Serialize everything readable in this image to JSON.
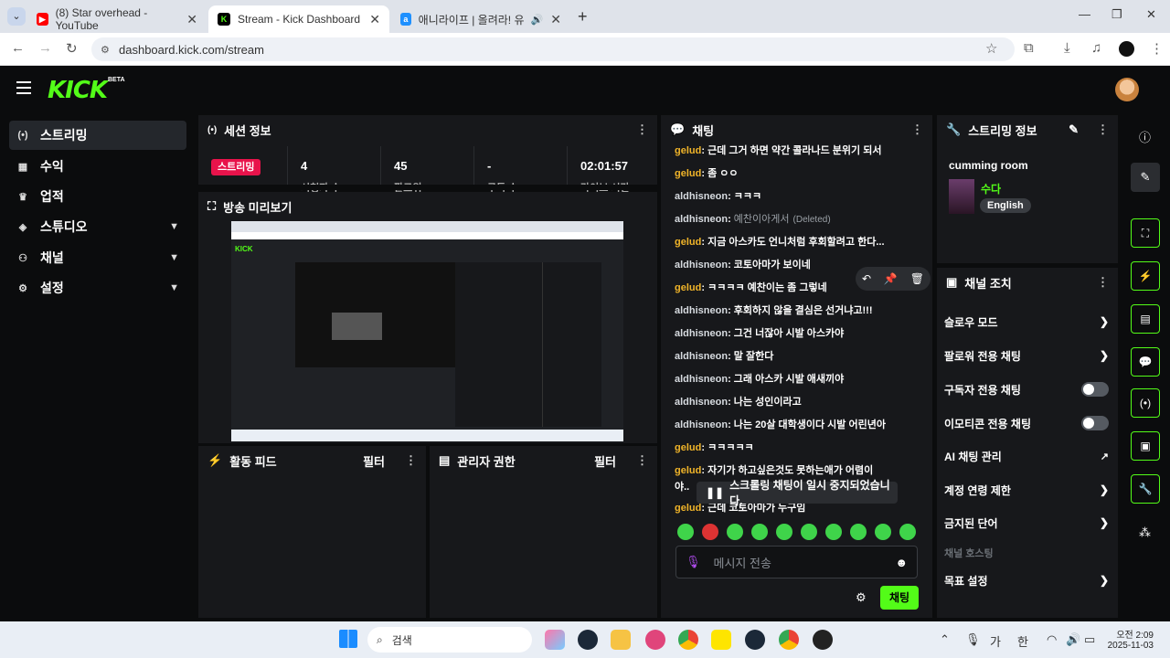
{
  "browser": {
    "tabs": [
      {
        "title": "(8) Star overhead - YouTube",
        "color": "#ff0000",
        "glyph": "▶"
      },
      {
        "title": "Stream - Kick Dashboard",
        "color": "#53fc18",
        "glyph": "K"
      },
      {
        "title": "애니라이프 | 올려라! 유포니",
        "color": "#1e90ff",
        "glyph": "a"
      }
    ],
    "url": "dashboard.kick.com/stream"
  },
  "header": {
    "logo": "KICK",
    "beta": "BETA"
  },
  "sidebar": {
    "items": [
      {
        "label": "스트리밍",
        "icon": "broadcast-icon",
        "glyph": "(•)"
      },
      {
        "label": "수익",
        "icon": "chart-icon",
        "glyph": "▦"
      },
      {
        "label": "업적",
        "icon": "trophy-icon",
        "glyph": "♛"
      },
      {
        "label": "스튜디오",
        "icon": "layers-icon",
        "glyph": "◈",
        "chev": "⌄"
      },
      {
        "label": "채널",
        "icon": "users-icon",
        "glyph": "⚇",
        "chev": "⌄"
      },
      {
        "label": "설정",
        "icon": "gear-icon",
        "glyph": "⚙",
        "chev": "⌄"
      }
    ]
  },
  "session": {
    "title": "세션 정보",
    "live": "스트리밍",
    "stats": [
      {
        "value": "4",
        "label": "시청자 수"
      },
      {
        "value": "45",
        "label": "팔로워"
      },
      {
        "value": "-",
        "label": "구독 수"
      },
      {
        "value": "02:01:57",
        "label": "라이브 시간"
      }
    ]
  },
  "preview": {
    "title": "방송 미리보기"
  },
  "activity": {
    "title": "활동 피드",
    "filter": "필터"
  },
  "modperm": {
    "title": "관리자 권한",
    "filter": "필터"
  },
  "chat": {
    "title": "채팅",
    "messages": [
      {
        "user": "gelud",
        "text": "근데 그거 하면 약간 콜라나드 분위기 되서",
        "t": "gelud: ",
        "msg": "근데 그거 하면 약간 콜라나드 분위기 되서"
      },
      {
        "user": "gelud",
        "msg": "좀 ㅇㅇ"
      },
      {
        "user": "aldhisneon",
        "msg": "ㅋㅋㅋ"
      },
      {
        "user": "aldhisneon",
        "msg": "예찬이아게서",
        "deleted": "(Deleted)"
      },
      {
        "user": "gelud",
        "msg": "지금 아스카도 언니처럼 후회할려고 한다..."
      },
      {
        "user": "aldhisneon",
        "msg": "코토아마가 보이네"
      },
      {
        "user": "gelud",
        "msg": "ㅋㅋㅋㅋ 예찬이는 좀 그렇네"
      },
      {
        "user": "aldhisneon",
        "msg": "후회하지 않을 결심은 선거냐고!!!"
      },
      {
        "user": "aldhisneon",
        "msg": "그건 너잖아 시발 아스카야"
      },
      {
        "user": "aldhisneon",
        "msg": "말 잘한다"
      },
      {
        "user": "aldhisneon",
        "msg": "그래 아스카 시발 애새끼야"
      },
      {
        "user": "aldhisneon",
        "msg": "나는 성인이라고"
      },
      {
        "user": "aldhisneon",
        "msg": "나는 20살 대학생이다 시발 어린년아"
      },
      {
        "user": "gelud",
        "msg": "ㅋㅋㅋㅋㅋ"
      },
      {
        "user": "gelud",
        "msg": "자기가 하고싶은것도 못하는애가 어렴이"
      },
      {
        "user": "",
        "msg": "야.."
      },
      {
        "user": "gelud",
        "msg": "근데 코토아마가 누구임"
      }
    ],
    "paused": "스크롤링 채팅이 일시 중지되었습니다.",
    "placeholder": "메시지 전송",
    "send": "채팅"
  },
  "stream_info": {
    "title": "스트리밍 정보",
    "name": "cumming room",
    "category": "수다",
    "language": "English"
  },
  "channel_actions": {
    "title": "채널 조치",
    "rows": [
      {
        "label": "슬로우 모드",
        "type": "chevron"
      },
      {
        "label": "팔로워 전용 채팅",
        "type": "chevron"
      },
      {
        "label": "구독자 전용 채팅",
        "type": "toggle"
      },
      {
        "label": "이모티콘 전용 채팅",
        "type": "toggle"
      },
      {
        "label": "AI 채팅 관리",
        "type": "external"
      },
      {
        "label": "계정 연령 제한",
        "type": "chevron"
      },
      {
        "label": "금지된 단어",
        "type": "chevron"
      },
      {
        "label": "채널 호스팅",
        "type": "disabled"
      },
      {
        "label": "목표 설정",
        "type": "chevron"
      }
    ]
  },
  "taskbar": {
    "search": "검색",
    "ime": "가",
    "time": "오전 2:09",
    "date": "2025-11-03"
  },
  "colors": {
    "accent": "#53fc18",
    "live": "#e8134b",
    "username": "#f0b429"
  }
}
